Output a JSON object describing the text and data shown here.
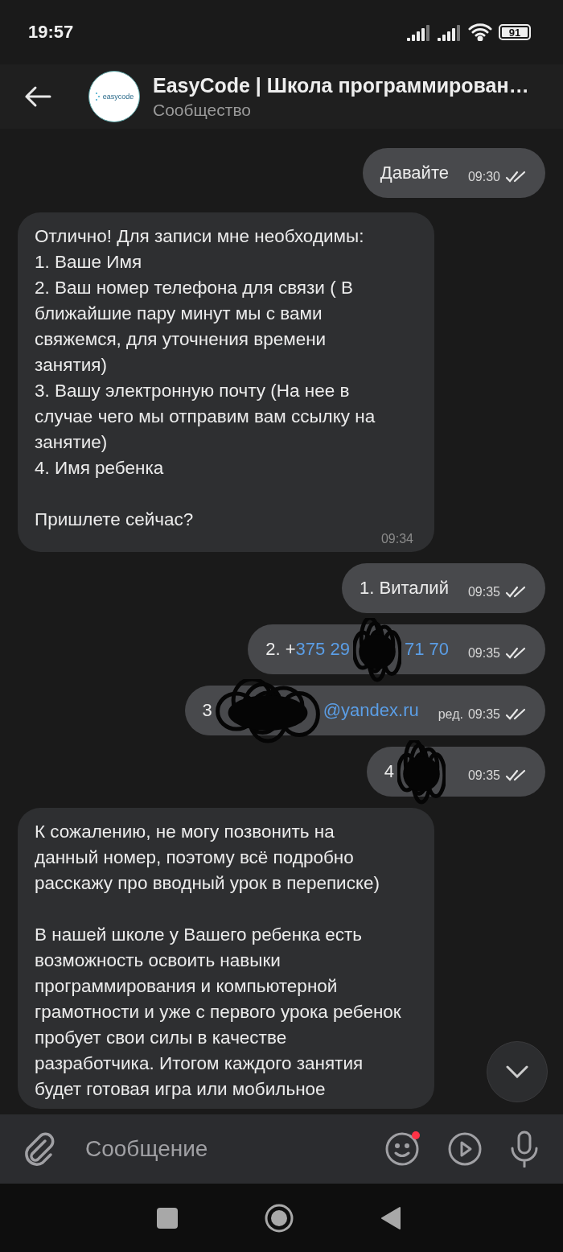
{
  "status_bar": {
    "time": "19:57",
    "battery": "91"
  },
  "header": {
    "title": "EasyCode | Школа программирован…",
    "subtitle": "Сообщество",
    "logo_text": "easycode"
  },
  "messages": [
    {
      "kind": "outgoing",
      "parts": [
        {
          "kind": "text",
          "text": "Давайте"
        }
      ],
      "time": "09:30"
    },
    {
      "kind": "incoming",
      "parts": [
        {
          "kind": "text",
          "text": "Отлично! Для записи мне необходимы:\n1. Ваше Имя\n2. Ваш номер телефона для связи ( В ближайшие пару минут мы с вами свяжемся, для уточнения времени занятия)\n3. Вашу электронную почту (На нее в случае чего мы отправим вам ссылку на занятие)\n4. Имя ребенка\n\nПришлете сейчас?"
        }
      ],
      "time": "09:34"
    },
    {
      "kind": "outgoing",
      "parts": [
        {
          "kind": "text",
          "text": "1. Виталий"
        }
      ],
      "time": "09:35"
    },
    {
      "kind": "outgoing",
      "parts": [
        {
          "kind": "text",
          "text": "2. + "
        },
        {
          "kind": "link",
          "text": "375 29"
        },
        {
          "kind": "scribble"
        },
        {
          "kind": "link",
          "text": "71 70"
        }
      ],
      "time": "09:35"
    },
    {
      "kind": "outgoing",
      "parts": [
        {
          "kind": "text",
          "text": "3"
        },
        {
          "kind": "scribble"
        },
        {
          "kind": "link",
          "text": "@yandex.ru"
        }
      ],
      "edited": "ред.",
      "time": "09:35"
    },
    {
      "kind": "outgoing",
      "parts": [
        {
          "kind": "text",
          "text": "4"
        },
        {
          "kind": "scribble"
        }
      ],
      "time": "09:35"
    },
    {
      "kind": "incoming",
      "parts": [
        {
          "kind": "text",
          "text": "К сожалению, не могу позвонить на данный номер, поэтому всё подробно расскажу про вводный урок в переписке)\n\nВ нашей школе у Вашего ребенка есть возможность освоить навыки программирования и компьютерной грамотности и уже с первого урока ребенок пробует свои силы в качестве разработчика. Итогом каждого занятия будет готовая игра или мобильное"
        }
      ]
    }
  ],
  "composer": {
    "placeholder": "Сообщение",
    "emoji_badge": true
  }
}
